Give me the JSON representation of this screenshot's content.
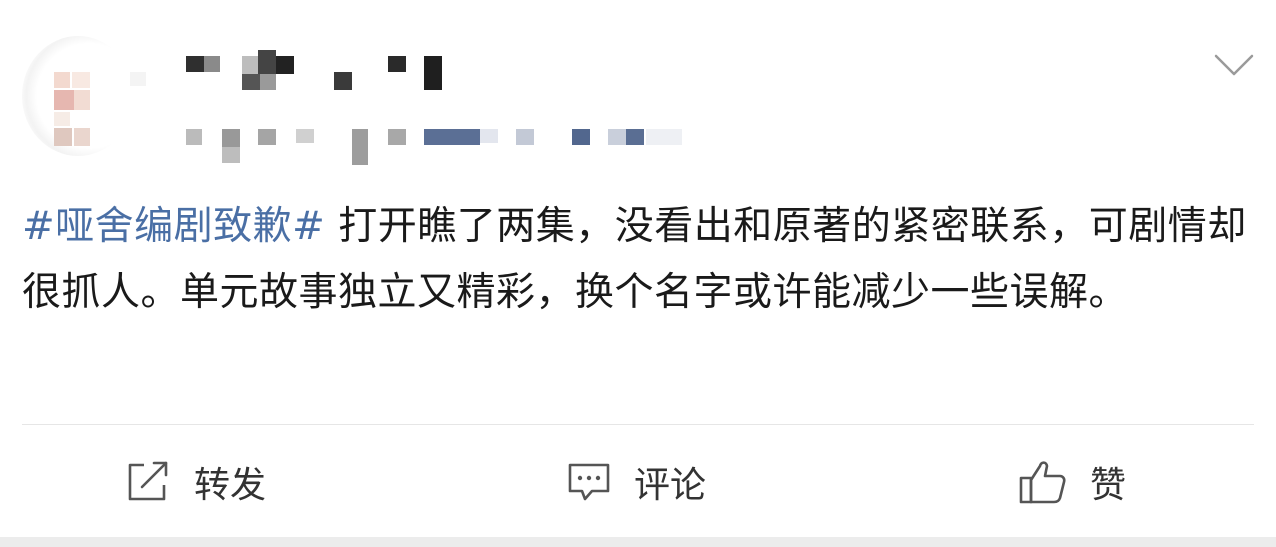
{
  "post": {
    "hashtag": "#哑舍编剧致歉#",
    "body": " 打开瞧了两集，没看出和原著的紧密联系，可剧情却很抓人。单元故事独立又精彩，换个名字或许能减少一些误解。"
  },
  "actions": {
    "repost_label": "转发",
    "comment_label": "评论",
    "like_label": "赞"
  },
  "icons": {
    "expand": "chevron-down-icon",
    "repost": "share-icon",
    "comment": "comment-icon",
    "like": "thumbs-up-icon"
  },
  "colors": {
    "hashtag": "#4a6fa5",
    "text": "#1a1a1a",
    "action_text": "#333333",
    "icon": "#555555"
  }
}
